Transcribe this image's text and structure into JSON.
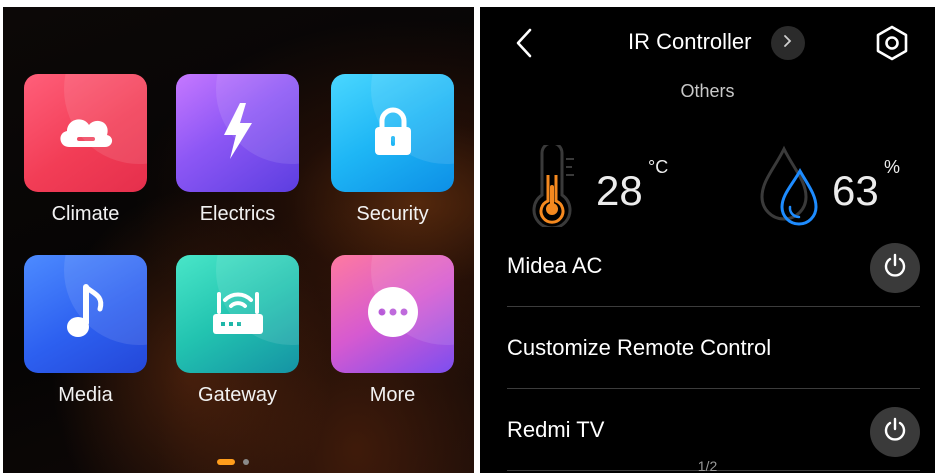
{
  "home": {
    "tiles": [
      {
        "label": "Climate",
        "icon": "cloud-icon",
        "color": "#f23d56"
      },
      {
        "label": "Electrics",
        "icon": "lightning-icon",
        "color": "#8d57f5"
      },
      {
        "label": "Security",
        "icon": "lock-icon",
        "color": "#1eb6f5"
      },
      {
        "label": "Media",
        "icon": "music-note-icon",
        "color": "#2d60f0"
      },
      {
        "label": "Gateway",
        "icon": "router-icon",
        "color": "#22c3b0"
      },
      {
        "label": "More",
        "icon": "more-dots-icon",
        "color": "#d65ad0"
      }
    ],
    "pager": {
      "pages": 2,
      "active": 1,
      "active_color": "#ff9d1c"
    }
  },
  "ir": {
    "title": "IR Controller",
    "subtitle": "Others",
    "temperature": {
      "value": "28",
      "unit": "°C",
      "icon": "thermometer-icon",
      "accent": "#f5891f"
    },
    "humidity": {
      "value": "63",
      "unit": "%",
      "icon": "water-drop-icon",
      "accent": "#1e8cff"
    },
    "devices": [
      {
        "name": "Midea AC",
        "has_power": true
      },
      {
        "name": "Customize Remote Control",
        "has_power": false
      },
      {
        "name": "Redmi TV",
        "has_power": true
      }
    ],
    "page_indicator": "1/2"
  }
}
